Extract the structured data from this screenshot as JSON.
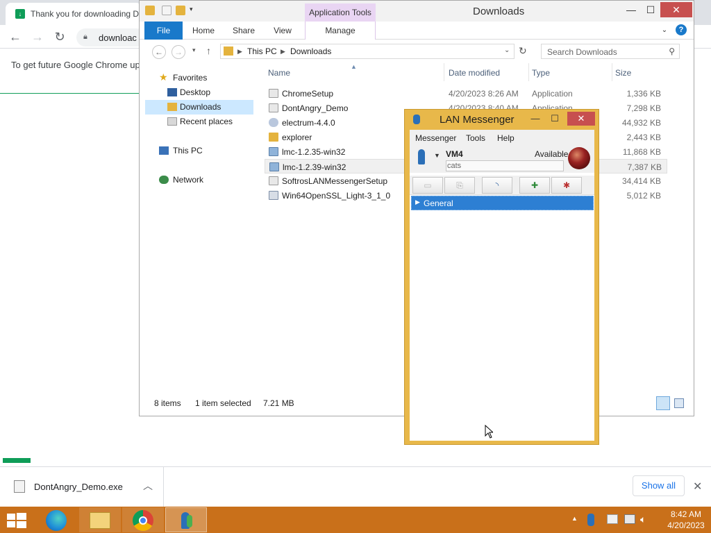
{
  "chrome": {
    "tab_title": "Thank you for downloading D",
    "url": "downloac",
    "infobar_text": "To get future Google Chrome up",
    "download_item": "DontAngry_Demo.exe",
    "show_all": "Show all"
  },
  "explorer": {
    "title": "Downloads",
    "app_tools": "Application Tools",
    "ribbon_tabs": [
      "File",
      "Home",
      "Share",
      "View",
      "Manage"
    ],
    "breadcrumb": [
      "This PC",
      "Downloads"
    ],
    "search_placeholder": "Search Downloads",
    "nav": {
      "favorites": "Favorites",
      "desktop": "Desktop",
      "downloads": "Downloads",
      "recent": "Recent places",
      "this_pc": "This PC",
      "network": "Network"
    },
    "columns": [
      "Name",
      "Date modified",
      "Type",
      "Size"
    ],
    "files": [
      {
        "name": "ChromeSetup",
        "date": "4/20/2023 8:26 AM",
        "type": "Application",
        "size": "1,336 KB"
      },
      {
        "name": "DontAngry_Demo",
        "date": "4/20/2023 8:40 AM",
        "type": "Application",
        "size": "7,298 KB"
      },
      {
        "name": "electrum-4.4.0",
        "date": "",
        "type": "",
        "size": "44,932 KB"
      },
      {
        "name": "explorer",
        "date": "",
        "type": "",
        "size": "2,443 KB"
      },
      {
        "name": "lmc-1.2.35-win32",
        "date": "",
        "type": "",
        "size": "11,868 KB"
      },
      {
        "name": "lmc-1.2.39-win32",
        "date": "",
        "type": "",
        "size": "7,387 KB"
      },
      {
        "name": "SoftrosLANMessengerSetup",
        "date": "",
        "type": "",
        "size": "34,414 KB"
      },
      {
        "name": "Win64OpenSSL_Light-3_1_0",
        "date": "",
        "type": "...",
        "size": "5,012 KB"
      }
    ],
    "status": {
      "items": "8 items",
      "selected": "1 item selected",
      "size": "7.21 MB"
    }
  },
  "lan_messenger": {
    "title": "LAN Messenger",
    "menu": [
      "Messenger",
      "Tools",
      "Help"
    ],
    "user_name": "VM4",
    "status": "Available",
    "note": "cats",
    "group": "General"
  },
  "taskbar": {
    "time": "8:42 AM",
    "date": "4/20/2023"
  },
  "colors": {
    "explorer_accent": "#1979ca",
    "app_tools": "#e9d5f3",
    "lan_frame": "#e8b84a",
    "selection": "#2d7fd3",
    "taskbar": "#c9701a",
    "close_red": "#c7504f"
  }
}
